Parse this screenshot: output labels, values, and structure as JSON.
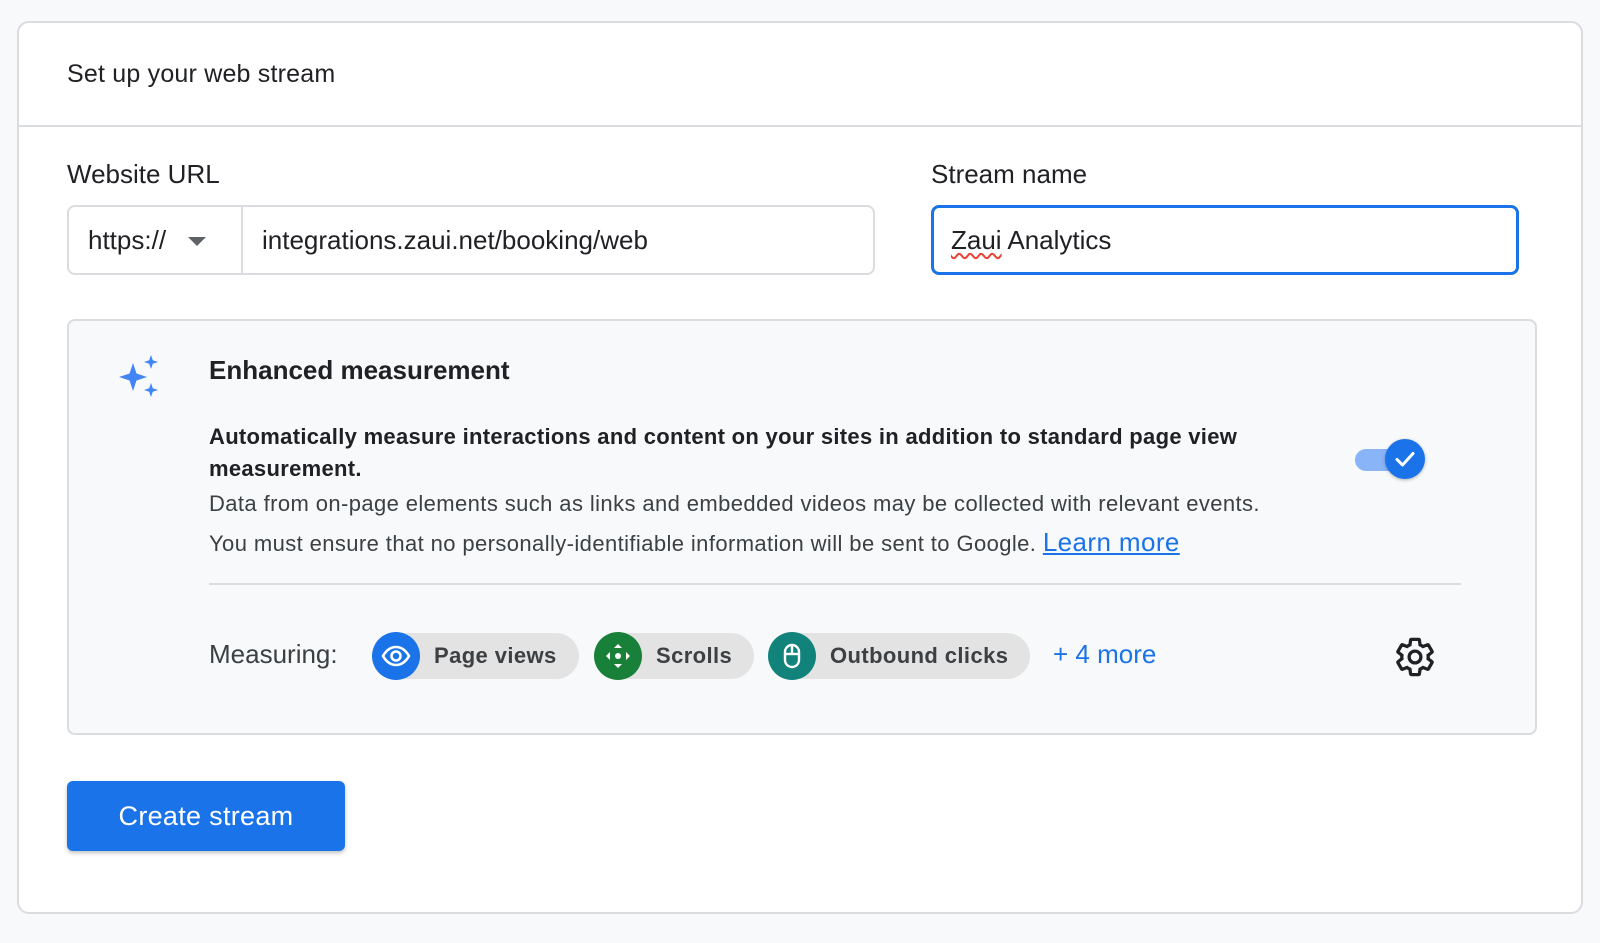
{
  "header": {
    "title": "Set up your web stream"
  },
  "website_url": {
    "label": "Website URL",
    "protocol": "https://",
    "value": "integrations.zaui.net/booking/web"
  },
  "stream_name": {
    "label": "Stream name",
    "value_misspelled": "Zaui",
    "value_rest": " Analytics"
  },
  "enhanced_measurement": {
    "icon": "sparkle-icon",
    "title": "Enhanced measurement",
    "description": "Automatically measure interactions and content on your sites in addition to standard page view measurement.",
    "line1": "Data from on-page elements such as links and embedded videos may be collected with relevant events.",
    "line2": "You must ensure that no personally-identifiable information will be sent to Google.",
    "learn_more": "Learn more",
    "toggle_on": true,
    "measuring_label": "Measuring:",
    "chips": [
      {
        "label": "Page views",
        "icon": "eye-icon",
        "color": "#1a73e8"
      },
      {
        "label": "Scrolls",
        "icon": "scroll-icon",
        "color": "#188038"
      },
      {
        "label": "Outbound clicks",
        "icon": "mouse-icon",
        "color": "#12837a"
      }
    ],
    "more": "+ 4 more",
    "settings_icon": "gear-icon"
  },
  "actions": {
    "create_label": "Create stream"
  },
  "colors": {
    "accent": "#1a73e8",
    "border": "#dadce0"
  }
}
